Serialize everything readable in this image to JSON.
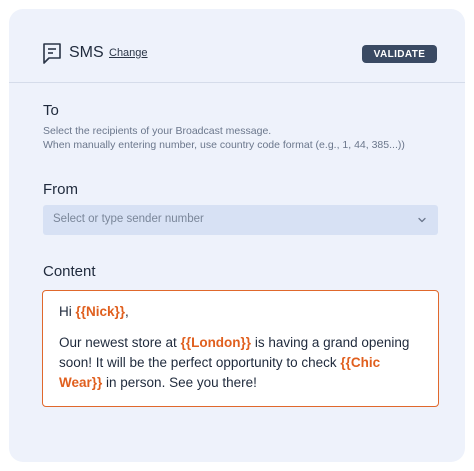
{
  "header": {
    "title": "SMS",
    "change_label": "Change",
    "validate_label": "VALIDATE",
    "icon": "message-square-icon"
  },
  "to": {
    "label": "To",
    "help_line1": "Select the recipients of your Broadcast message.",
    "help_line2": "When manually entering number, use country code format (e.g., 1, 44, 385...))"
  },
  "from": {
    "label": "From",
    "placeholder": "Select or type sender number"
  },
  "content": {
    "label": "Content",
    "greeting_prefix": "Hi ",
    "var_name": "{{Nick}}",
    "greeting_suffix": ",",
    "body_1": "Our newest store at ",
    "var_city": "{{London}}",
    "body_2": " is having a grand opening soon! It will be the perfect opportunity to check ",
    "var_store": "{{Chic Wear}}",
    "body_3": " in person. See you there!"
  },
  "colors": {
    "accent": "#e0682c",
    "button": "#3a4a63",
    "card_bg": "#eef2fb"
  }
}
